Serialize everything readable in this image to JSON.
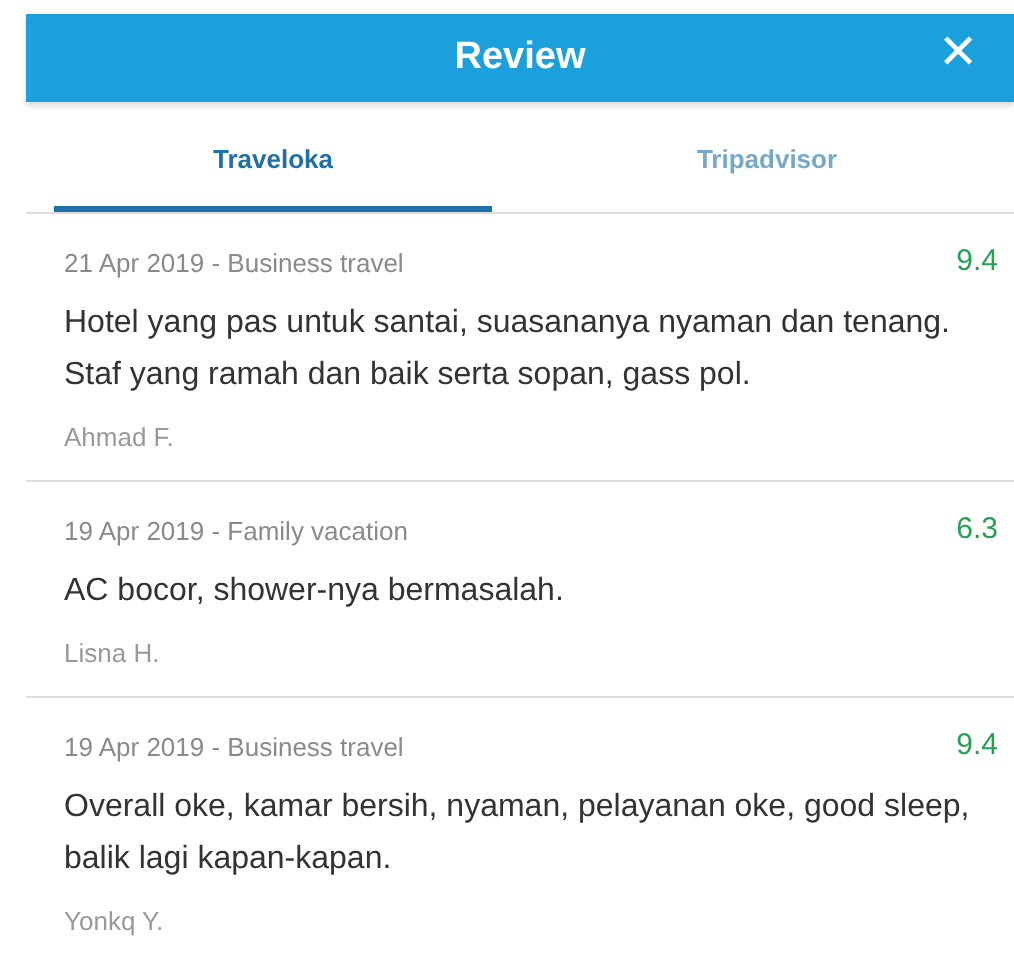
{
  "header": {
    "title": "Review",
    "close": "✕"
  },
  "tabs": [
    {
      "label": "Traveloka",
      "selected": true
    },
    {
      "label": "Tripadvisor",
      "selected": false
    }
  ],
  "reviews": [
    {
      "meta": "21 Apr 2019 - Business travel",
      "score": "9.4",
      "text": "Hotel yang pas untuk santai, suasananya nyaman dan tenang. Staf yang ramah dan baik serta sopan, gass pol.",
      "author": "Ahmad F."
    },
    {
      "meta": "19 Apr 2019 - Family vacation",
      "score": "6.3",
      "text": "AC bocor, shower-nya bermasalah.",
      "author": "Lisna H."
    },
    {
      "meta": "19 Apr 2019 - Business travel",
      "score": "9.4",
      "text": "Overall oke, kamar bersih, nyaman, pelayanan oke, good sleep, balik lagi kapan-kapan.",
      "author": "Yonkq Y."
    }
  ]
}
